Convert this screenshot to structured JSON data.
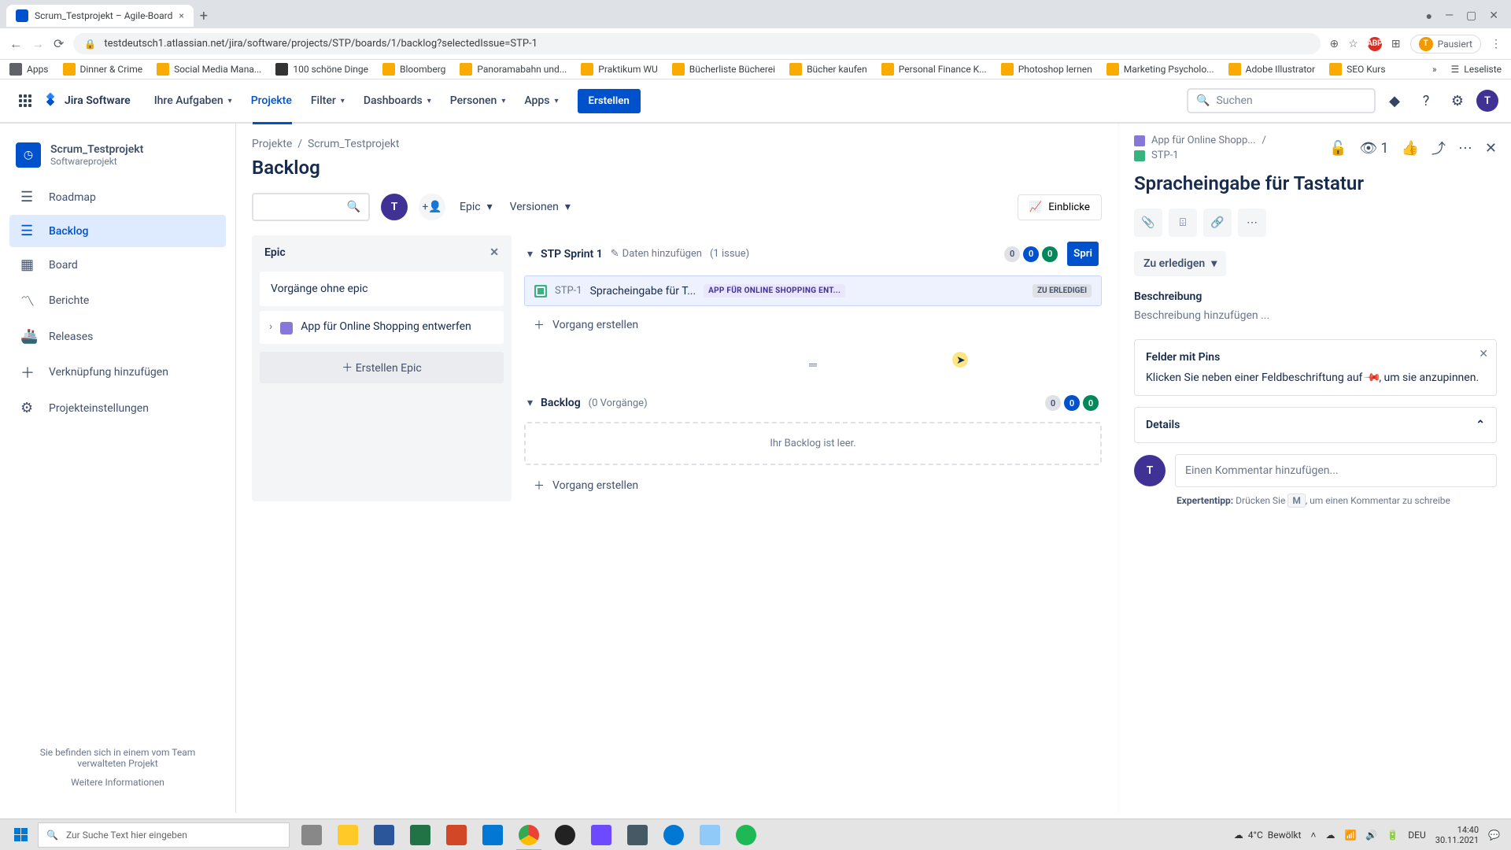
{
  "browser": {
    "tab_title": "Scrum_Testprojekt – Agile-Board",
    "url": "testdeutsch1.atlassian.net/jira/software/projects/STP/boards/1/backlog?selectedIssue=STP-1",
    "pausiert": "Pausiert",
    "bookmarks": [
      "Apps",
      "Dinner & Crime",
      "Social Media Mana...",
      "100 schöne Dinge",
      "Bloomberg",
      "Panoramabahn und...",
      "Praktikum WU",
      "Bücherliste Bücherei",
      "Bücher kaufen",
      "Personal Finance K...",
      "Photoshop lernen",
      "Marketing Psycholo...",
      "Adobe Illustrator",
      "SEO Kurs"
    ],
    "reading_list": "Leseliste"
  },
  "jira_nav": {
    "logo": "Jira Software",
    "items": [
      "Ihre Aufgaben",
      "Projekte",
      "Filter",
      "Dashboards",
      "Personen",
      "Apps"
    ],
    "create": "Erstellen",
    "search_placeholder": "Suchen"
  },
  "sidebar": {
    "project_name": "Scrum_Testprojekt",
    "project_type": "Softwareprojekt",
    "items": [
      "Roadmap",
      "Backlog",
      "Board",
      "Berichte",
      "Releases",
      "Verknüpfung hinzufügen",
      "Projekteinstellungen"
    ],
    "footer_text": "Sie befinden sich in einem vom Team verwalteten Projekt",
    "footer_link": "Weitere Informationen"
  },
  "breadcrumb": {
    "projects": "Projekte",
    "project": "Scrum_Testprojekt"
  },
  "page": {
    "title": "Backlog",
    "epic_filter": "Epic",
    "versions_filter": "Versionen",
    "insights": "Einblicke"
  },
  "epic_panel": {
    "title": "Epic",
    "no_epic": "Vorgänge ohne epic",
    "epic_name": "App für Online Shopping entwerfen",
    "create": "Erstellen Epic"
  },
  "sprint": {
    "name": "STP Sprint 1",
    "add_dates": "Daten hinzufügen",
    "count": "(1 issue)",
    "pills": [
      "0",
      "0",
      "0"
    ],
    "start_btn": "Spri",
    "issue_key": "STP-1",
    "issue_title": "Spracheingabe für T...",
    "epic_tag": "APP FÜR ONLINE SHOPPING ENT...",
    "status_tag": "ZU ERLEDIGEI",
    "create_issue": "Vorgang erstellen"
  },
  "backlog_sec": {
    "title": "Backlog",
    "count": "(0 Vorgänge)",
    "pills": [
      "0",
      "0",
      "0"
    ],
    "empty": "Ihr Backlog ist leer.",
    "create_issue": "Vorgang erstellen"
  },
  "detail": {
    "epic_crumb": "App für Online Shopp...",
    "issue_key": "STP-1",
    "watch_count": "1",
    "title": "Spracheingabe für Tastatur",
    "status": "Zu erledigen",
    "desc_label": "Beschreibung",
    "desc_placeholder": "Beschreibung hinzufügen ...",
    "pins_title": "Felder mit Pins",
    "pins_text_1": "Klicken Sie neben einer Feldbeschriftung auf ",
    "pins_text_2": ", um sie anzupinnen.",
    "details_label": "Details",
    "comment_placeholder": "Einen Kommentar hinzufügen...",
    "tip_label": "Expertentipp:",
    "tip_text_1": "Drücken Sie ",
    "tip_key": "M",
    "tip_text_2": ", um einen Kommentar zu schreibe"
  },
  "taskbar": {
    "search_placeholder": "Zur Suche Text hier eingeben",
    "weather_temp": "4°C",
    "weather_text": "Bewölkt",
    "lang": "DEU",
    "time": "14:40",
    "date": "30.11.2021"
  }
}
